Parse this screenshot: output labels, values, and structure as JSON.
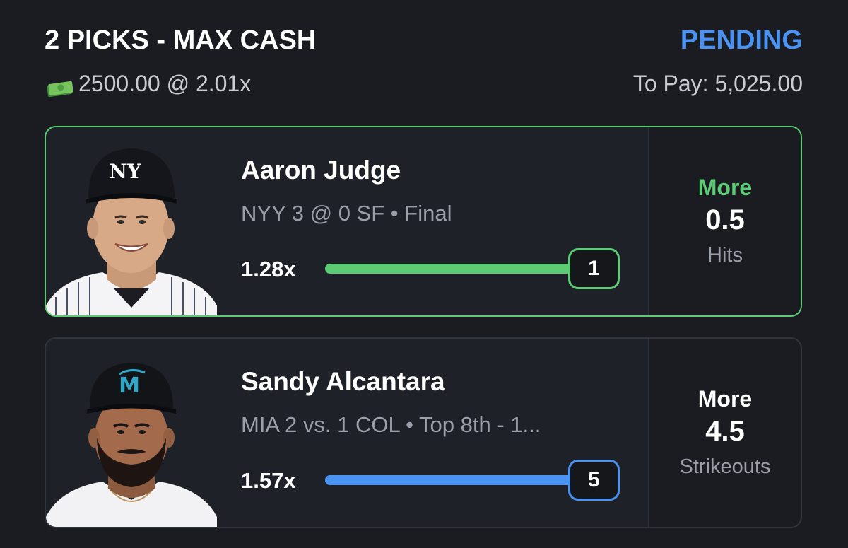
{
  "header": {
    "title": "2 PICKS - MAX CASH",
    "status": "PENDING",
    "wager": "2500.00 @ 2.01x",
    "to_pay": "To Pay: 5,025.00"
  },
  "picks": [
    {
      "player": "Aaron Judge",
      "game": "NYY 3 @ 0 SF • Final",
      "multiplier": "1.28x",
      "current_stat": "1",
      "progress": 1.0,
      "direction": "More",
      "line": "0.5",
      "stat_type": "Hits",
      "status_color": "#5ccb74"
    },
    {
      "player": "Sandy Alcantara",
      "game": "MIA 2 vs. 1 COL • Top 8th  -  1...",
      "multiplier": "1.57x",
      "current_stat": "5",
      "progress": 1.0,
      "direction": "More",
      "line": "4.5",
      "stat_type": "Strikeouts",
      "status_color": "#4a93f2"
    }
  ],
  "colors": {
    "background": "#1a1c21",
    "card": "#1e2127",
    "accent_green": "#5ccb74",
    "accent_blue": "#4a93f2",
    "muted_text": "#9a9fa9"
  }
}
